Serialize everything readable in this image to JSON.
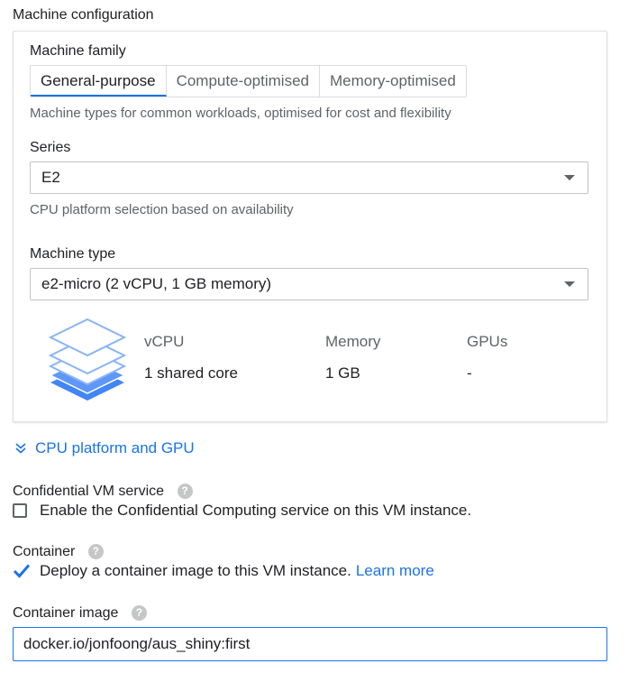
{
  "machine_configuration": {
    "title": "Machine configuration",
    "machine_family": {
      "label": "Machine family",
      "tabs": [
        {
          "label": "General-purpose",
          "active": true
        },
        {
          "label": "Compute-optimised",
          "active": false
        },
        {
          "label": "Memory-optimised",
          "active": false
        }
      ],
      "helper": "Machine types for common workloads, optimised for cost and flexibility"
    },
    "series": {
      "label": "Series",
      "value": "E2",
      "helper": "CPU platform selection based on availability"
    },
    "machine_type": {
      "label": "Machine type",
      "value": "e2-micro (2 vCPU, 1 GB memory)"
    },
    "specs": {
      "headers": [
        "vCPU",
        "Memory",
        "GPUs"
      ],
      "values": [
        "1 shared core",
        "1 GB",
        "-"
      ]
    },
    "cpu_platform_link": "CPU platform and GPU"
  },
  "confidential_vm": {
    "label": "Confidential VM service",
    "checkbox_label": "Enable the Confidential Computing service on this VM instance.",
    "checked": false
  },
  "container": {
    "label": "Container",
    "checkbox_label": "Deploy a container image to this VM instance.",
    "learn_more": "Learn more",
    "checked": true
  },
  "container_image": {
    "label": "Container image",
    "value": "docker.io/jonfoong/aus_shiny:first"
  },
  "colors": {
    "accent": "#1a73e8",
    "stack_icon": "#4285f4"
  }
}
